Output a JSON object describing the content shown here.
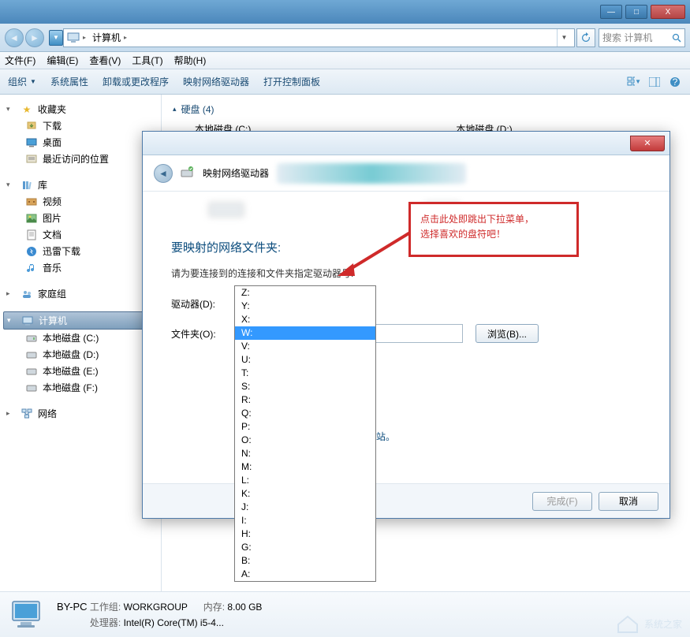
{
  "window": {
    "min": "—",
    "max": "□",
    "close": "X"
  },
  "nav": {
    "crumb": "计算机",
    "search_placeholder": "搜索 计算机"
  },
  "menu": {
    "file": "文件(F)",
    "edit": "编辑(E)",
    "view": "查看(V)",
    "tools": "工具(T)",
    "help": "帮助(H)"
  },
  "toolbar": {
    "organize": "组织",
    "sysprop": "系统属性",
    "uninstall": "卸载或更改程序",
    "mapdrive": "映射网络驱动器",
    "controlpanel": "打开控制面板"
  },
  "sidebar": {
    "favorites": "收藏夹",
    "downloads": "下载",
    "desktop": "桌面",
    "recent": "最近访问的位置",
    "libraries": "库",
    "videos": "视频",
    "pictures": "图片",
    "documents": "文档",
    "xunlei": "迅雷下载",
    "music": "音乐",
    "homegroup": "家庭组",
    "computer": "计算机",
    "diskC": "本地磁盘 (C:)",
    "diskD": "本地磁盘 (D:)",
    "diskE": "本地磁盘 (E:)",
    "diskF": "本地磁盘 (F:)",
    "network": "网络"
  },
  "content": {
    "harddisk_header": "硬盘 (4)",
    "disk1": "本地磁盘 (C:)",
    "disk2": "本地磁盘 (D:)"
  },
  "dialog": {
    "title": "映射网络驱动器",
    "heading": "要映射的网络文件夹:",
    "subtext": "请为要连接到的连接和文件夹指定驱动器号:",
    "drive_label": "驱动器(D):",
    "drive_value": "Z:",
    "folder_label": "文件夹(O):",
    "browse": "浏览(B)...",
    "link_suffix": "站。",
    "finish": "完成(F)",
    "cancel": "取消",
    "drive_options": [
      "Z:",
      "Y:",
      "X:",
      "W:",
      "V:",
      "U:",
      "T:",
      "S:",
      "R:",
      "Q:",
      "P:",
      "O:",
      "N:",
      "M:",
      "L:",
      "K:",
      "J:",
      "I:",
      "H:",
      "G:",
      "B:",
      "A:"
    ],
    "selected_option": "W:"
  },
  "callout": {
    "line1": "点击此处即跳出下拉菜单，",
    "line2": "选择喜欢的盘符吧！"
  },
  "status": {
    "name": "BY-PC",
    "workgroup_label": "工作组:",
    "workgroup": "WORKGROUP",
    "mem_label": "内存:",
    "mem": "8.00 GB",
    "cpu_label": "处理器:",
    "cpu": "Intel(R) Core(TM) i5-4..."
  },
  "watermark": "系统之家"
}
